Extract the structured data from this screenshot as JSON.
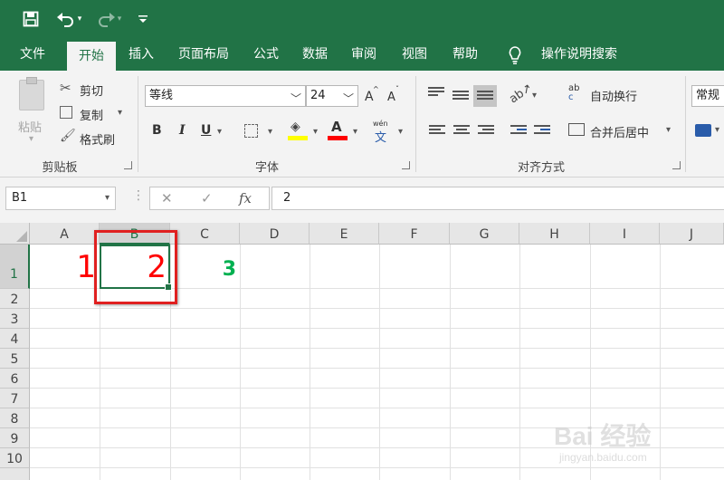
{
  "quick_access": {
    "save_icon": "save-icon",
    "undo_icon": "undo-icon",
    "redo_icon": "redo-icon",
    "customize_icon": "customize-icon"
  },
  "tabs": [
    {
      "label": "文件"
    },
    {
      "label": "开始",
      "active": true
    },
    {
      "label": "插入"
    },
    {
      "label": "页面布局"
    },
    {
      "label": "公式"
    },
    {
      "label": "数据"
    },
    {
      "label": "审阅"
    },
    {
      "label": "视图"
    },
    {
      "label": "帮助"
    }
  ],
  "tell_me": "操作说明搜索",
  "clipboard": {
    "paste": "粘贴",
    "cut": "剪切",
    "copy": "复制",
    "format_painter": "格式刷",
    "group_label": "剪贴板"
  },
  "font": {
    "name": "等线",
    "size": "24",
    "bold": "B",
    "italic": "I",
    "underline": "U",
    "wen": "wén",
    "wen_char": "文",
    "grow": "A",
    "shrink": "A",
    "group_label": "字体",
    "fill_color": "#ffff00",
    "font_color": "#ff0000"
  },
  "alignment": {
    "wrap_text": "自动换行",
    "merge_center": "合并后居中",
    "group_label": "对齐方式",
    "ab": "ab",
    "c": "c"
  },
  "number": {
    "format": "常规"
  },
  "formula_bar": {
    "name_box": "B1",
    "cancel": "✕",
    "enter": "✓",
    "fx": "fx",
    "content": "2"
  },
  "grid": {
    "columns": [
      "A",
      "B",
      "C",
      "D",
      "E",
      "F",
      "G",
      "H",
      "I",
      "J"
    ],
    "rows": [
      "1",
      "2",
      "3",
      "4",
      "5",
      "6",
      "7",
      "8",
      "9",
      "10"
    ],
    "selected_col": "B",
    "selected_row": "1",
    "cells": {
      "A1": {
        "value": "1",
        "color": "#ff0000"
      },
      "B1": {
        "value": "2",
        "color": "#ff0000"
      },
      "C1": {
        "value": "3",
        "color": "#00b050"
      }
    }
  },
  "watermark": {
    "line1": "Bai 经验",
    "line2": "jingyan.baidu.com"
  }
}
